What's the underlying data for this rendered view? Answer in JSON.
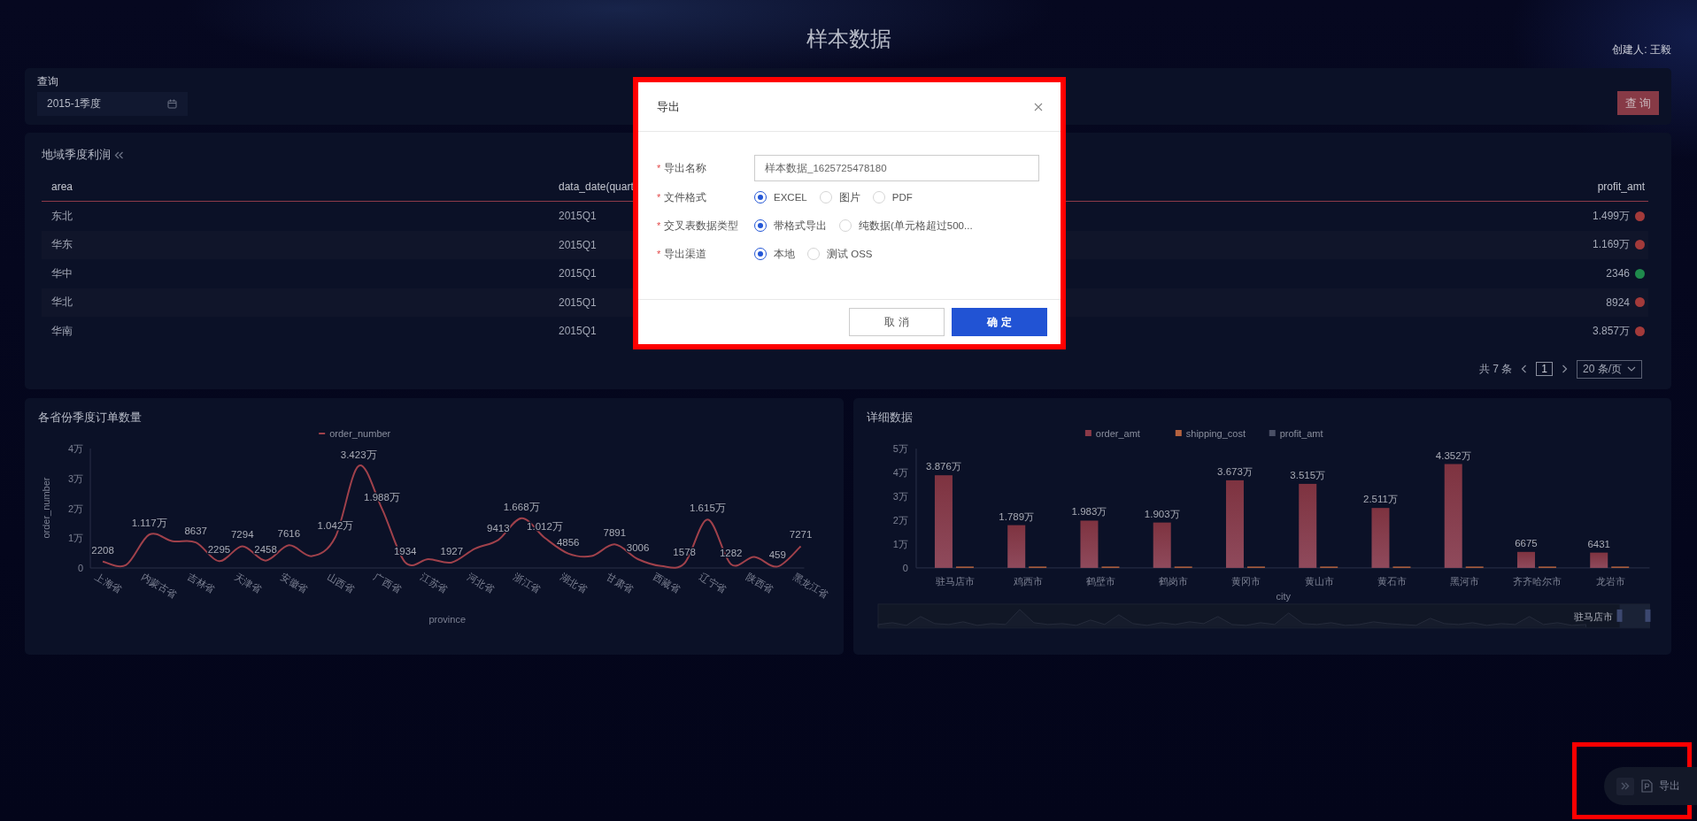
{
  "header": {
    "title": "样本数据",
    "creator": "创建人: 王毅"
  },
  "query": {
    "label": "查询",
    "date": "2015-1季度",
    "button": "查 询"
  },
  "profit_table": {
    "title": "地域季度利润",
    "columns": [
      "area",
      "data_date(quart",
      "profit_amt"
    ],
    "rows": [
      {
        "area": "东北",
        "data_date": "2015Q1",
        "profit_amt": "1.499万",
        "color": "#a33a3a"
      },
      {
        "area": "华东",
        "data_date": "2015Q1",
        "profit_amt": "1.169万",
        "color": "#a33a3a"
      },
      {
        "area": "华中",
        "data_date": "2015Q1",
        "profit_amt": "2346",
        "color": "#1f8a4c"
      },
      {
        "area": "华北",
        "data_date": "2015Q1",
        "profit_amt": "8924",
        "color": "#a33a3a"
      },
      {
        "area": "华南",
        "data_date": "2015Q1",
        "profit_amt": "3.857万",
        "color": "#a33a3a"
      }
    ],
    "pagination": {
      "total": "共 7 条",
      "page": "1",
      "page_size": "20 条/页"
    }
  },
  "order_chart": {
    "title": "各省份季度订单数量",
    "chart_data": {
      "type": "line",
      "legend": "top",
      "xlabel": "province",
      "ylabel": "order_number",
      "categories": [
        "上海省",
        null,
        "内蒙古省",
        null,
        "吉林省",
        null,
        "天津省",
        null,
        "安徽省",
        null,
        "山西省",
        null,
        "广西省",
        null,
        "江苏省",
        null,
        "河北省",
        null,
        "浙江省",
        null,
        "湖北省",
        null,
        "甘肃省",
        null,
        "西藏省",
        null,
        "辽宁省",
        null,
        "陕西省",
        null,
        "黑龙江省"
      ],
      "ylim": [
        0,
        4
      ],
      "yticks": [
        {
          "value": 0,
          "label": "0"
        },
        {
          "value": 1,
          "label": "1万"
        },
        {
          "value": 2,
          "label": "2万"
        },
        {
          "value": 3,
          "label": "3万"
        },
        {
          "value": 4,
          "label": "4万"
        }
      ],
      "series": [
        {
          "name": "order_number",
          "color": "#a0414b",
          "values": [
            0.22,
            0.1,
            1.12,
            0.9,
            0.86,
            0.23,
            0.73,
            0.25,
            0.76,
            0.4,
            1.04,
            3.42,
            1.99,
            0.19,
            0.3,
            0.19,
            0.65,
            0.94,
            1.67,
            1.01,
            0.49,
            0.4,
            0.79,
            0.3,
            0.07,
            0.16,
            1.62,
            0.13,
            0.37,
            0.05,
            0.73
          ]
        }
      ],
      "value_labels": [
        "2208",
        null,
        "1.117万",
        null,
        "8637",
        "2295",
        "7294",
        "2458",
        "7616",
        null,
        "1.042万",
        "3.423万",
        "1.988万",
        "1934",
        null,
        "1927",
        null,
        "9413",
        "1.668万",
        "1.012万",
        "4856",
        null,
        "7891",
        "3006",
        null,
        "1578",
        "1.615万",
        "1282",
        null,
        "459",
        "7271"
      ]
    }
  },
  "detail_chart": {
    "title": "详细数据",
    "zoom_label": "驻马店市",
    "chart_data": {
      "type": "bar",
      "legend": "top",
      "xlabel": "city",
      "categories": [
        "驻马店市",
        "鸡西市",
        "鹤壁市",
        "鹤岗市",
        "黄冈市",
        "黄山市",
        "黄石市",
        "黑河市",
        "齐齐哈尔市",
        "龙岩市"
      ],
      "ylim": [
        0,
        5
      ],
      "yticks": [
        {
          "value": 0,
          "label": "0"
        },
        {
          "value": 1,
          "label": "1万"
        },
        {
          "value": 2,
          "label": "2万"
        },
        {
          "value": 3,
          "label": "3万"
        },
        {
          "value": 4,
          "label": "4万"
        },
        {
          "value": 5,
          "label": "5万"
        }
      ],
      "series": [
        {
          "name": "order_amt",
          "color": "#8c3a48",
          "values": [
            3.88,
            1.79,
            1.98,
            1.9,
            3.67,
            3.52,
            2.51,
            4.35,
            0.67,
            0.64
          ]
        },
        {
          "name": "shipping_cost",
          "color": "#b5623f",
          "values": [
            0,
            0,
            0,
            0,
            0,
            0,
            0,
            0,
            0,
            0
          ]
        },
        {
          "name": "profit_amt",
          "color": "#4a5066",
          "values": [
            null,
            null,
            null,
            null,
            null,
            null,
            null,
            null,
            null,
            null
          ]
        }
      ],
      "value_labels": [
        "3.876万",
        "1.789万",
        "1.983万",
        "1.903万",
        "3.673万",
        "3.515万",
        "2.511万",
        "4.352万",
        "6675",
        "6431"
      ]
    }
  },
  "export_dialog": {
    "title": "导出",
    "fields": [
      {
        "kind": "text",
        "marker": "*",
        "label": "导出名称",
        "value": "样本数据_1625725478180"
      },
      {
        "kind": "radio",
        "marker": "*",
        "label": "文件格式",
        "options": [
          {
            "label": "EXCEL",
            "selected": true
          },
          {
            "label": "图片",
            "selected": false
          },
          {
            "label": "PDF",
            "selected": false
          }
        ]
      },
      {
        "kind": "radio",
        "marker": "*",
        "label": "交叉表数据类型",
        "options": [
          {
            "label": "带格式导出",
            "selected": true
          },
          {
            "label": "纯数据(单元格超过500...",
            "selected": false
          }
        ]
      },
      {
        "kind": "radio",
        "marker": "*",
        "label": "导出渠道",
        "options": [
          {
            "label": "本地",
            "selected": true
          },
          {
            "label": "测试 OSS",
            "selected": false
          }
        ]
      }
    ],
    "buttons": [
      {
        "kind": "secondary",
        "label": "取 消"
      },
      {
        "kind": "primary",
        "label": "确 定"
      }
    ]
  },
  "export_dock": {
    "label": "导出"
  }
}
